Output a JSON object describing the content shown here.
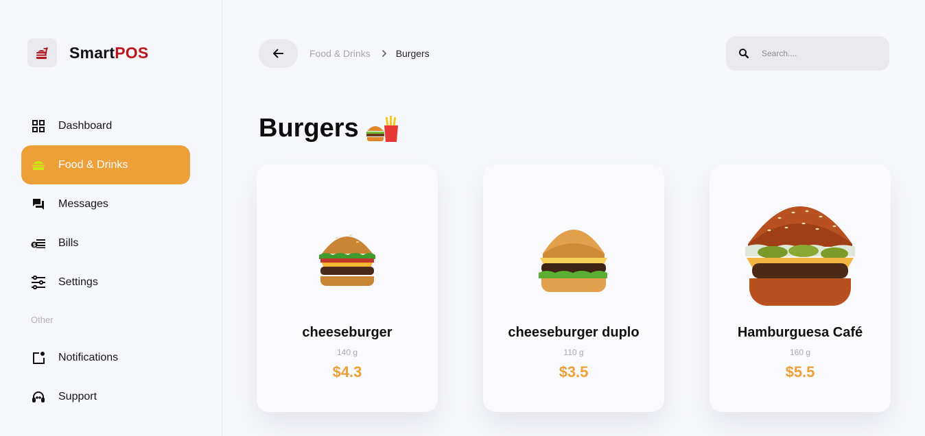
{
  "brand": {
    "name_part1": "Smart",
    "name_part2": "POS",
    "accent_color": "#c0141c"
  },
  "sidebar": {
    "items": [
      {
        "label": "Dashboard",
        "icon": "grid-icon"
      },
      {
        "label": "Food & Drinks",
        "icon": "burger-icon",
        "active": true
      },
      {
        "label": "Messages",
        "icon": "chat-icon"
      },
      {
        "label": "Bills",
        "icon": "money-icon"
      },
      {
        "label": "Settings",
        "icon": "sliders-icon"
      }
    ],
    "other_label": "Other",
    "other_items": [
      {
        "label": "Notifications",
        "icon": "notification-icon"
      },
      {
        "label": "Support",
        "icon": "headset-icon"
      }
    ],
    "active_color": "#eda037"
  },
  "breadcrumb": {
    "parent": "Food & Drinks",
    "current": "Burgers"
  },
  "search": {
    "placeholder": "Search...."
  },
  "page": {
    "title": "Burgers"
  },
  "products": [
    {
      "name": "cheeseburger",
      "weight": "140 g",
      "price": "$4.3"
    },
    {
      "name": "cheeseburger duplo",
      "weight": "110 g",
      "price": "$3.5"
    },
    {
      "name": "Hamburguesa Café",
      "weight": "160 g",
      "price": "$5.5"
    }
  ]
}
